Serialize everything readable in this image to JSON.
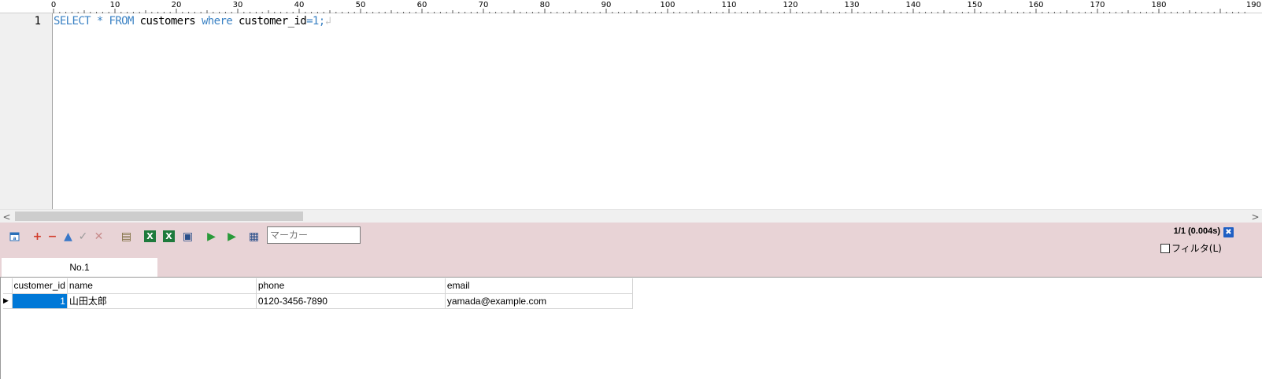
{
  "ruler": {
    "labels": [
      "0",
      "10",
      "20",
      "30",
      "40",
      "50",
      "60",
      "70",
      "80",
      "90",
      "100",
      "110",
      "120",
      "130",
      "140",
      "150",
      "160",
      "170",
      "180",
      "190"
    ]
  },
  "editor": {
    "line_number": "1",
    "tokens": [
      {
        "text": "SELECT",
        "kind": "kw"
      },
      {
        "text": " ",
        "kind": "id"
      },
      {
        "text": "*",
        "kind": "op"
      },
      {
        "text": " ",
        "kind": "id"
      },
      {
        "text": "FROM",
        "kind": "kw"
      },
      {
        "text": " customers ",
        "kind": "id"
      },
      {
        "text": "where",
        "kind": "kw"
      },
      {
        "text": " customer_id",
        "kind": "id"
      },
      {
        "text": "=1;",
        "kind": "op"
      },
      {
        "text": "↲",
        "kind": "eol"
      }
    ]
  },
  "scrollbar": {
    "left_arrow": "<",
    "right_arrow": ">"
  },
  "toolbar": {
    "icons": [
      {
        "name": "refresh-calendar-icon",
        "glyph": "📅",
        "color": "#2a6fb8"
      },
      {
        "name": "add-row-icon",
        "glyph": "+",
        "color": "#d23b2a"
      },
      {
        "name": "delete-row-icon",
        "glyph": "−",
        "color": "#d23b2a"
      },
      {
        "name": "up-icon",
        "glyph": "▲",
        "color": "#3a78c8"
      },
      {
        "name": "commit-check-icon",
        "glyph": "✓",
        "color": "#9a9a9a"
      },
      {
        "name": "cancel-x-icon",
        "glyph": "✕",
        "color": "#c78a8a"
      },
      {
        "name": "export-file-icon",
        "glyph": "▤",
        "color": "#7a6a3a"
      },
      {
        "name": "excel-icon",
        "glyph": "X",
        "color": "#1e7a3c"
      },
      {
        "name": "excel-all-icon",
        "glyph": "X",
        "color": "#1e7a3c"
      },
      {
        "name": "copy-icon",
        "glyph": "▣",
        "color": "#2a4f8a"
      },
      {
        "name": "compare-ab-icon",
        "glyph": "▶",
        "color": "#2a9a3a"
      },
      {
        "name": "run-query-icon",
        "glyph": "▶",
        "color": "#2a9a3a"
      },
      {
        "name": "grid-view-icon",
        "glyph": "▦",
        "color": "#2a4f8a"
      }
    ],
    "marker_placeholder": "マーカー",
    "status": "1/1 (0.004s)",
    "filter_label": "フィルタ(L)"
  },
  "tabs": [
    {
      "label": "No.1"
    }
  ],
  "grid": {
    "columns": [
      "customer_id",
      "name",
      "phone",
      "email"
    ],
    "rows": [
      {
        "customer_id": "1",
        "name": "山田太郎",
        "phone": "0120-3456-7890",
        "email": "yamada@example.com"
      }
    ]
  }
}
